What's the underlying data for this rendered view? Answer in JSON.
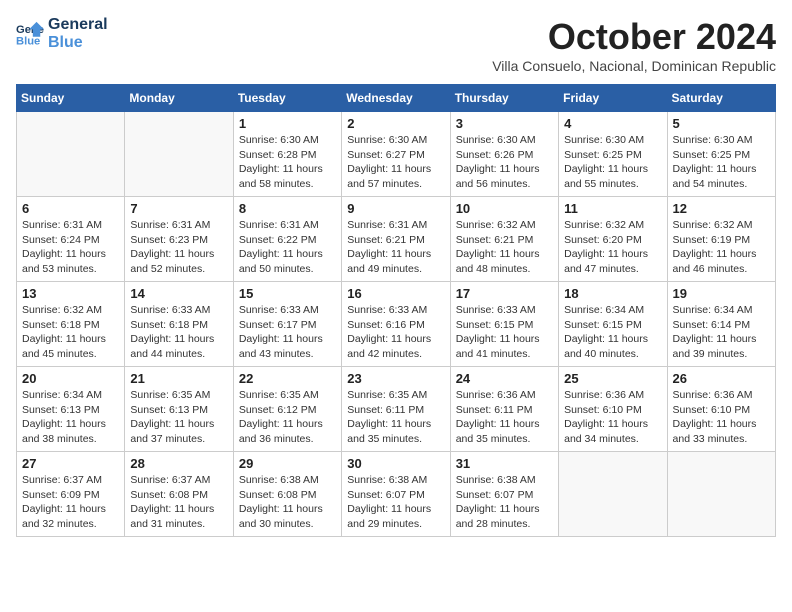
{
  "logo": {
    "line1": "General",
    "line2": "Blue"
  },
  "title": "October 2024",
  "subtitle": "Villa Consuelo, Nacional, Dominican Republic",
  "days_of_week": [
    "Sunday",
    "Monday",
    "Tuesday",
    "Wednesday",
    "Thursday",
    "Friday",
    "Saturday"
  ],
  "weeks": [
    [
      {
        "day": "",
        "info": ""
      },
      {
        "day": "",
        "info": ""
      },
      {
        "day": "1",
        "info": "Sunrise: 6:30 AM\nSunset: 6:28 PM\nDaylight: 11 hours and 58 minutes."
      },
      {
        "day": "2",
        "info": "Sunrise: 6:30 AM\nSunset: 6:27 PM\nDaylight: 11 hours and 57 minutes."
      },
      {
        "day": "3",
        "info": "Sunrise: 6:30 AM\nSunset: 6:26 PM\nDaylight: 11 hours and 56 minutes."
      },
      {
        "day": "4",
        "info": "Sunrise: 6:30 AM\nSunset: 6:25 PM\nDaylight: 11 hours and 55 minutes."
      },
      {
        "day": "5",
        "info": "Sunrise: 6:30 AM\nSunset: 6:25 PM\nDaylight: 11 hours and 54 minutes."
      }
    ],
    [
      {
        "day": "6",
        "info": "Sunrise: 6:31 AM\nSunset: 6:24 PM\nDaylight: 11 hours and 53 minutes."
      },
      {
        "day": "7",
        "info": "Sunrise: 6:31 AM\nSunset: 6:23 PM\nDaylight: 11 hours and 52 minutes."
      },
      {
        "day": "8",
        "info": "Sunrise: 6:31 AM\nSunset: 6:22 PM\nDaylight: 11 hours and 50 minutes."
      },
      {
        "day": "9",
        "info": "Sunrise: 6:31 AM\nSunset: 6:21 PM\nDaylight: 11 hours and 49 minutes."
      },
      {
        "day": "10",
        "info": "Sunrise: 6:32 AM\nSunset: 6:21 PM\nDaylight: 11 hours and 48 minutes."
      },
      {
        "day": "11",
        "info": "Sunrise: 6:32 AM\nSunset: 6:20 PM\nDaylight: 11 hours and 47 minutes."
      },
      {
        "day": "12",
        "info": "Sunrise: 6:32 AM\nSunset: 6:19 PM\nDaylight: 11 hours and 46 minutes."
      }
    ],
    [
      {
        "day": "13",
        "info": "Sunrise: 6:32 AM\nSunset: 6:18 PM\nDaylight: 11 hours and 45 minutes."
      },
      {
        "day": "14",
        "info": "Sunrise: 6:33 AM\nSunset: 6:18 PM\nDaylight: 11 hours and 44 minutes."
      },
      {
        "day": "15",
        "info": "Sunrise: 6:33 AM\nSunset: 6:17 PM\nDaylight: 11 hours and 43 minutes."
      },
      {
        "day": "16",
        "info": "Sunrise: 6:33 AM\nSunset: 6:16 PM\nDaylight: 11 hours and 42 minutes."
      },
      {
        "day": "17",
        "info": "Sunrise: 6:33 AM\nSunset: 6:15 PM\nDaylight: 11 hours and 41 minutes."
      },
      {
        "day": "18",
        "info": "Sunrise: 6:34 AM\nSunset: 6:15 PM\nDaylight: 11 hours and 40 minutes."
      },
      {
        "day": "19",
        "info": "Sunrise: 6:34 AM\nSunset: 6:14 PM\nDaylight: 11 hours and 39 minutes."
      }
    ],
    [
      {
        "day": "20",
        "info": "Sunrise: 6:34 AM\nSunset: 6:13 PM\nDaylight: 11 hours and 38 minutes."
      },
      {
        "day": "21",
        "info": "Sunrise: 6:35 AM\nSunset: 6:13 PM\nDaylight: 11 hours and 37 minutes."
      },
      {
        "day": "22",
        "info": "Sunrise: 6:35 AM\nSunset: 6:12 PM\nDaylight: 11 hours and 36 minutes."
      },
      {
        "day": "23",
        "info": "Sunrise: 6:35 AM\nSunset: 6:11 PM\nDaylight: 11 hours and 35 minutes."
      },
      {
        "day": "24",
        "info": "Sunrise: 6:36 AM\nSunset: 6:11 PM\nDaylight: 11 hours and 35 minutes."
      },
      {
        "day": "25",
        "info": "Sunrise: 6:36 AM\nSunset: 6:10 PM\nDaylight: 11 hours and 34 minutes."
      },
      {
        "day": "26",
        "info": "Sunrise: 6:36 AM\nSunset: 6:10 PM\nDaylight: 11 hours and 33 minutes."
      }
    ],
    [
      {
        "day": "27",
        "info": "Sunrise: 6:37 AM\nSunset: 6:09 PM\nDaylight: 11 hours and 32 minutes."
      },
      {
        "day": "28",
        "info": "Sunrise: 6:37 AM\nSunset: 6:08 PM\nDaylight: 11 hours and 31 minutes."
      },
      {
        "day": "29",
        "info": "Sunrise: 6:38 AM\nSunset: 6:08 PM\nDaylight: 11 hours and 30 minutes."
      },
      {
        "day": "30",
        "info": "Sunrise: 6:38 AM\nSunset: 6:07 PM\nDaylight: 11 hours and 29 minutes."
      },
      {
        "day": "31",
        "info": "Sunrise: 6:38 AM\nSunset: 6:07 PM\nDaylight: 11 hours and 28 minutes."
      },
      {
        "day": "",
        "info": ""
      },
      {
        "day": "",
        "info": ""
      }
    ]
  ]
}
